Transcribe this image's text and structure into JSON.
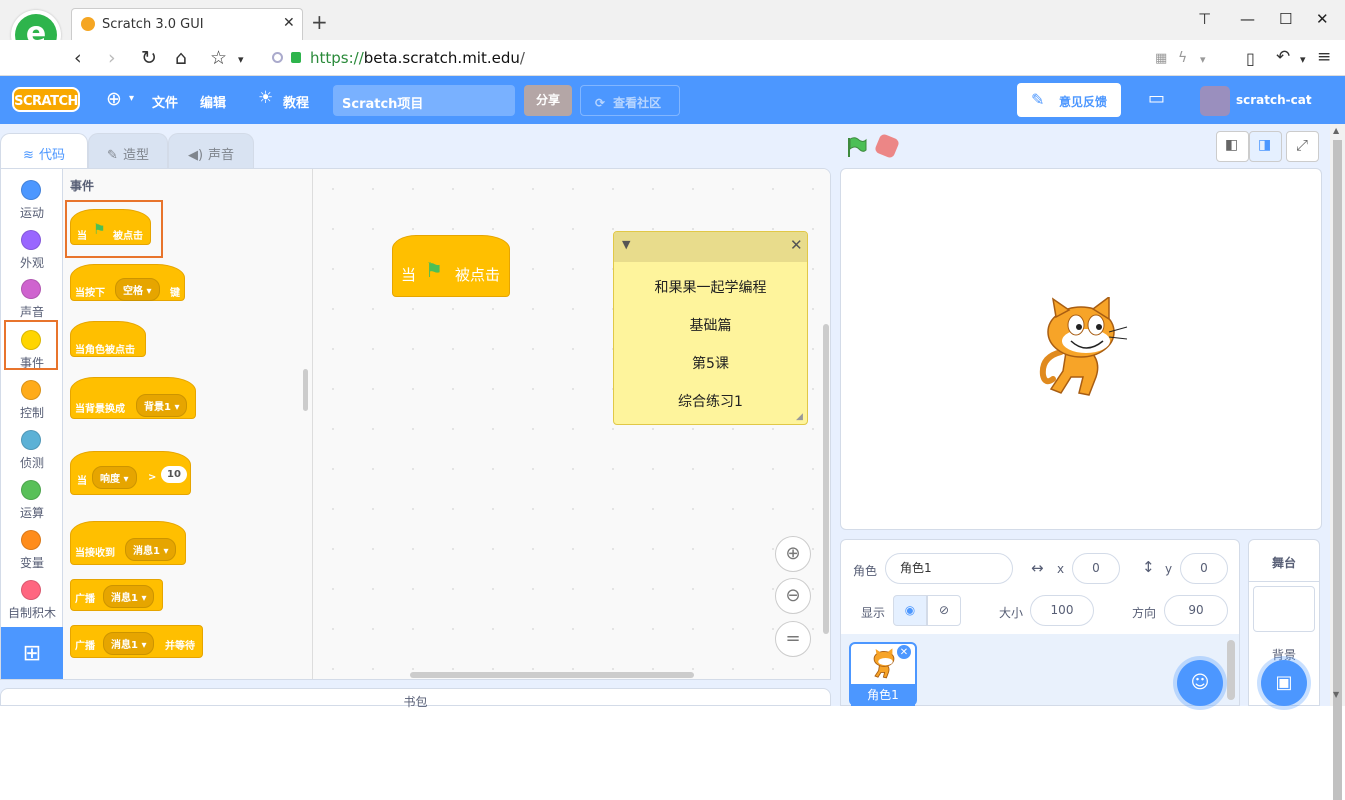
{
  "browser": {
    "tab_title": "Scratch 3.0 GUI",
    "url_scheme": "https://",
    "url_host": "beta.scratch.mit.edu",
    "url_path": "/"
  },
  "menubar": {
    "logo": "SCRATCH",
    "file": "文件",
    "edit": "编辑",
    "tutorials": "教程",
    "project_title": "Scratch项目",
    "share": "分享",
    "community": "查看社区",
    "feedback": "意见反馈",
    "username": "scratch-cat"
  },
  "editor_tabs": [
    {
      "label": "代码"
    },
    {
      "label": "造型"
    },
    {
      "label": "声音"
    }
  ],
  "categories": [
    {
      "label": "运动",
      "color": "#4c97ff"
    },
    {
      "label": "外观",
      "color": "#9966ff"
    },
    {
      "label": "声音",
      "color": "#cf63cf"
    },
    {
      "label": "事件",
      "color": "#ffd500"
    },
    {
      "label": "控制",
      "color": "#ffab19"
    },
    {
      "label": "侦测",
      "color": "#5cb1d6"
    },
    {
      "label": "运算",
      "color": "#59c059"
    },
    {
      "label": "变量",
      "color": "#ff8c1a"
    },
    {
      "label": "自制积木",
      "color": "#ff6680"
    }
  ],
  "flyout": {
    "title": "事件",
    "flag_clicked": {
      "pre": "当",
      "post": "被点击"
    },
    "key_pressed": {
      "pre": "当按下",
      "key": "空格",
      "post": "键"
    },
    "sprite_clicked": "当角色被点击",
    "backdrop_switch": {
      "pre": "当背景换成",
      "value": "背景1"
    },
    "greater_than": {
      "pre": "当",
      "sensor": "响度",
      "op": ">",
      "value": "10"
    },
    "receive": {
      "pre": "当接收到",
      "value": "消息1"
    },
    "broadcast": {
      "pre": "广播",
      "value": "消息1"
    },
    "broadcast_wait": {
      "pre": "广播",
      "value": "消息1",
      "post": "并等待"
    }
  },
  "workspace": {
    "block": {
      "pre": "当",
      "post": "被点击"
    },
    "note_lines": [
      "和果果一起学编程",
      "基础篇",
      "第5课",
      "综合练习1"
    ]
  },
  "backpack": "书包",
  "sprite_info": {
    "sprite_label": "角色",
    "sprite_name": "角色1",
    "x_label": "x",
    "x_value": "0",
    "y_label": "y",
    "y_value": "0",
    "show_label": "显示",
    "size_label": "大小",
    "size_value": "100",
    "direction_label": "方向",
    "direction_value": "90"
  },
  "sprites": [
    {
      "name": "角色1"
    }
  ],
  "stage_pane": {
    "title": "舞台",
    "backdrop_label": "背景"
  }
}
